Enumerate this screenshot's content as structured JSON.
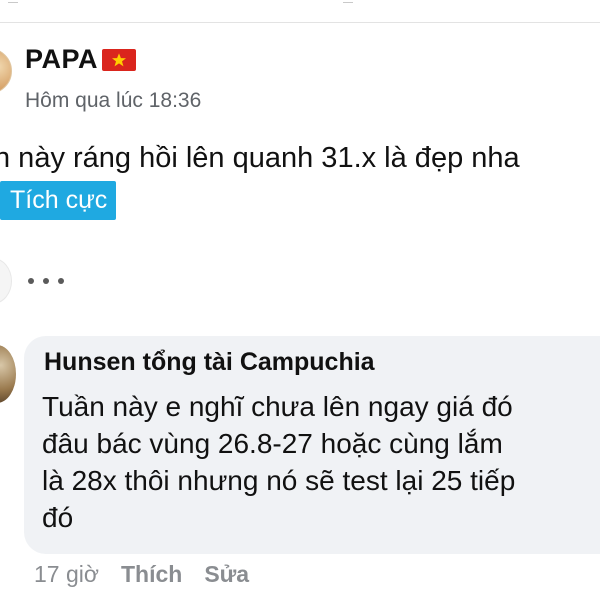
{
  "post": {
    "author": "PAPA",
    "author_flag": "vietnam-flag-icon",
    "timestamp": "Hôm qua lúc 18:36",
    "text": "n này ráng hồi lên quanh 31.x là đẹp nha",
    "tag": "Tích cực"
  },
  "more": {
    "icon": "more-dots-icon"
  },
  "reply": {
    "author": "Hunsen tổng tài Campuchia",
    "lines": [
      "Tuần này e nghĩ chưa lên ngay giá đó",
      "đâu bác vùng 26.8-27 hoặc cùng lắm",
      "là 28x thôi nhưng nó sẽ test lại 25 tiếp",
      "đó"
    ],
    "time_ago": "17 giờ",
    "like_label": "Thích",
    "edit_label": "Sửa"
  },
  "colors": {
    "tag_background": "#1fa9e1",
    "bubble_background": "#f0f2f5",
    "meta_text": "#8a8d91",
    "flag_red": "#da251d",
    "flag_star": "#ffcd00"
  }
}
